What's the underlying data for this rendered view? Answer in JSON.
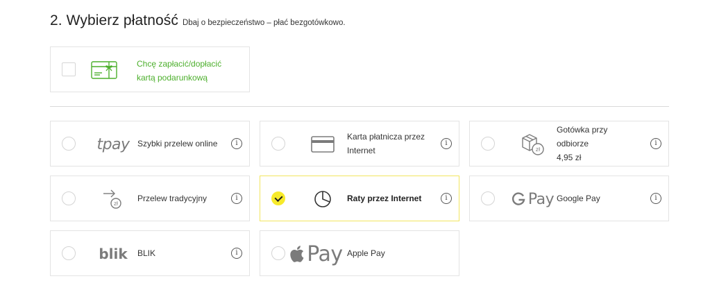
{
  "section": {
    "title": "2. Wybierz płatność",
    "subtitle": "Dbaj o bezpieczeństwo – płać bezgotówkowo."
  },
  "gift_card": {
    "line1": "Chcę zapłacić/dopłacić",
    "line2": "kartą podarunkową",
    "checked": false,
    "accent": "#4caf2c"
  },
  "methods": [
    {
      "id": "tpay",
      "logo_text": "tpay",
      "label": "Szybki przelew online",
      "selected": false,
      "icon": "tpay-logo"
    },
    {
      "id": "card",
      "label_line1": "Karta płatnicza przez",
      "label_line2": "Internet",
      "selected": false,
      "icon": "credit-card-icon"
    },
    {
      "id": "cod",
      "label_line1": "Gotówka przy",
      "label_line2": "odbiorze",
      "fee": "4,95 zł",
      "icon_badge": "zł",
      "selected": false,
      "icon": "package-cash-icon"
    },
    {
      "id": "transfer",
      "label": "Przelew tradycyjny",
      "icon_badge": "zł",
      "selected": false,
      "icon": "transfer-arrow-icon"
    },
    {
      "id": "installments",
      "label": "Raty przez Internet",
      "selected": true,
      "icon": "pie-chart-icon"
    },
    {
      "id": "gpay",
      "logo_text": "Pay",
      "label": "Google Pay",
      "selected": false,
      "icon": "google-pay-logo"
    },
    {
      "id": "blik",
      "logo_text": "blik",
      "label": "BLIK",
      "selected": false,
      "icon": "blik-logo"
    },
    {
      "id": "applepay",
      "logo_text": "Pay",
      "label": "Apple Pay",
      "selected": false,
      "icon": "apple-pay-logo"
    }
  ],
  "info_glyph": "i",
  "colors": {
    "selected_accent": "#f7ea2b",
    "selected_border": "#f2e55e",
    "border": "#e3e3e3",
    "logo_gray": "#7b7b7b"
  }
}
